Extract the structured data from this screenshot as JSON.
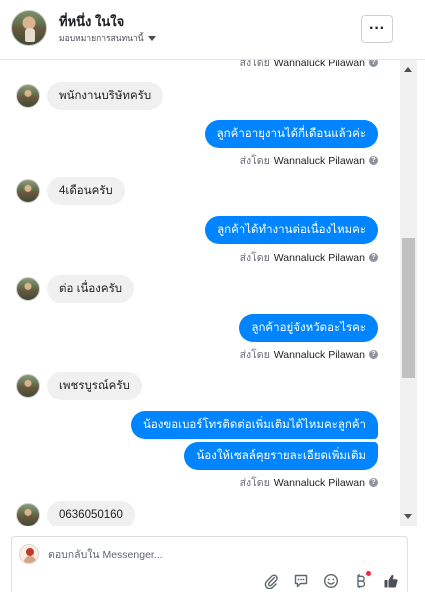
{
  "header": {
    "title": "ที่หนึ่ง ในใจ",
    "subtitle": "มอบหมายการสนทนานี้",
    "more_label": "···"
  },
  "thread": {
    "top_sent_by": {
      "label": "ส่งโดย",
      "name": "Wannaluck Pilawan"
    },
    "messages": [
      {
        "direction": "in",
        "text": "พนักงานบริษัทครับ"
      },
      {
        "direction": "out",
        "text": "ลูกค้าอายุงานได้กี่เดือนแล้วค่ะ",
        "sent_by_label": "ส่งโดย",
        "sent_by_name": "Wannaluck Pilawan"
      },
      {
        "direction": "in",
        "text": "4เดือนครับ"
      },
      {
        "direction": "out",
        "text": "ลูกค้าได้ทำงานต่อเนื่องไหมคะ",
        "sent_by_label": "ส่งโดย",
        "sent_by_name": "Wannaluck Pilawan"
      },
      {
        "direction": "in",
        "text": "ต่อ เนื่องครับ"
      },
      {
        "direction": "out",
        "text": "ลูกค้าอยู่จังหวัดอะไรคะ",
        "sent_by_label": "ส่งโดย",
        "sent_by_name": "Wannaluck Pilawan"
      },
      {
        "direction": "in",
        "text": "เพชรบูรณ์ครับ"
      },
      {
        "direction": "out",
        "text": "น้องขอเบอร์โทรติดต่อเพิ่มเติมได้ไหมคะลูกค้า"
      },
      {
        "direction": "out",
        "text": "น้องให้เซลล์คุยรายละเอียดเพิ่มเติม",
        "sent_by_label": "ส่งโดย",
        "sent_by_name": "Wannaluck Pilawan"
      },
      {
        "direction": "in",
        "text": "0636050160"
      }
    ]
  },
  "composer": {
    "placeholder": "ตอบกลับใน Messenger...",
    "tools": [
      "attachment-icon",
      "saved-replies-icon",
      "emoji-icon",
      "bitmoji-icon",
      "thumbs-up-icon"
    ]
  },
  "colors": {
    "outgoing_bubble": "#0084ff",
    "incoming_bubble": "#f1f0f0",
    "notification_dot": "#f02849"
  }
}
